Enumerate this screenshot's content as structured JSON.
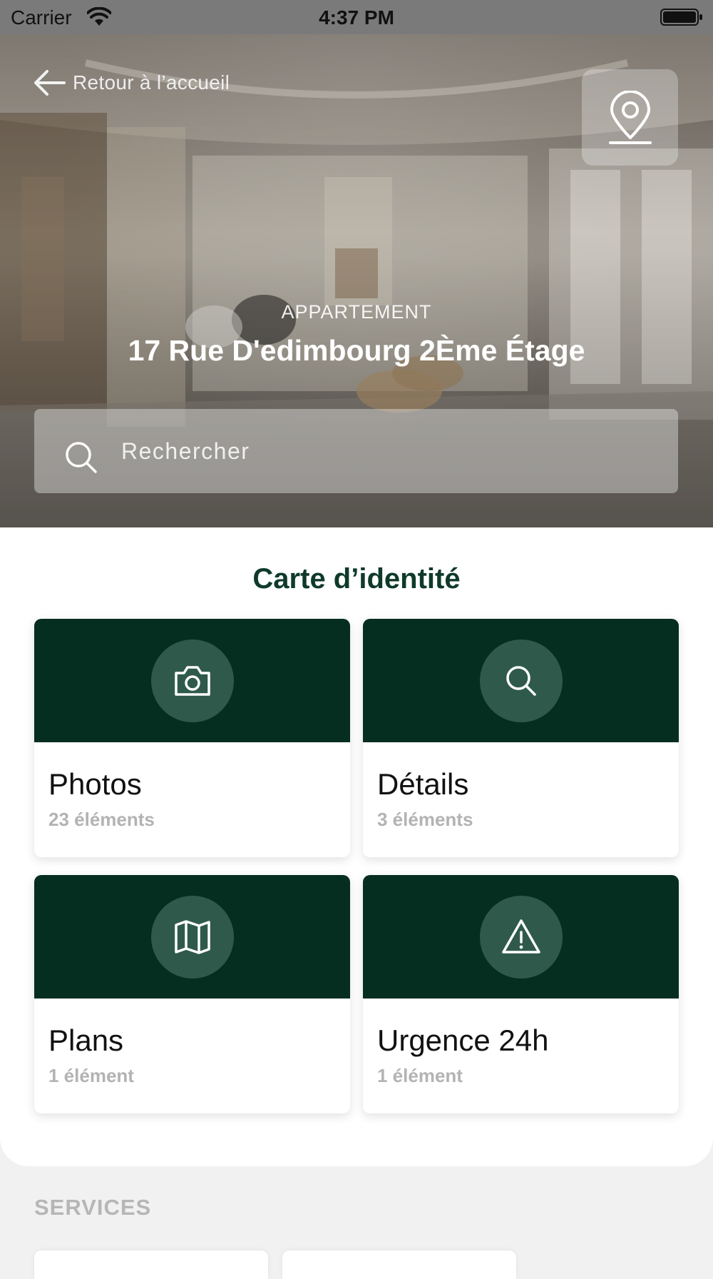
{
  "status_bar": {
    "carrier": "Carrier",
    "time": "4:37 PM"
  },
  "hero": {
    "back_label": "Retour à l’accueil",
    "property_type": "APPARTEMENT",
    "address": "17 Rue D'edimbourg 2Ème Étage",
    "search_placeholder": "Rechercher"
  },
  "identity": {
    "title": "Carte d’identité",
    "tiles": [
      {
        "title": "Photos",
        "count": "23 éléments",
        "icon": "camera-icon"
      },
      {
        "title": "Détails",
        "count": "3 éléments",
        "icon": "search-icon"
      },
      {
        "title": "Plans",
        "count": "1 élément",
        "icon": "map-icon"
      },
      {
        "title": "Urgence 24h",
        "count": "1 élément",
        "icon": "warning-icon"
      }
    ]
  },
  "services": {
    "label": "SERVICES"
  },
  "colors": {
    "brand_dark_green": "#062e20",
    "icon_circle_green": "#2f5a4b",
    "title_green": "#0f3a2a",
    "muted_gray": "#b3b3b3"
  }
}
